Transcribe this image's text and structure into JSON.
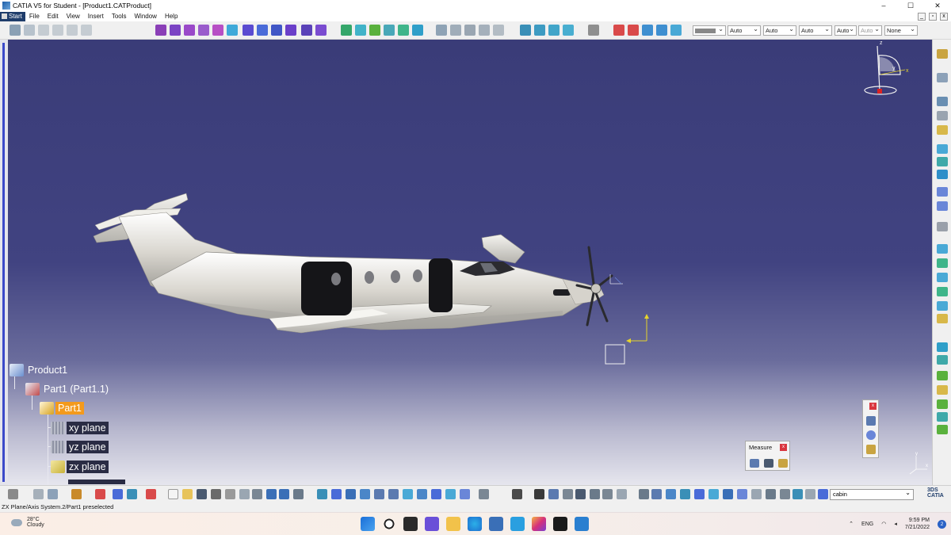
{
  "window": {
    "title": "CATIA V5 for Student - [Product1.CATProduct]",
    "controls": [
      "–",
      "☐",
      "✕"
    ]
  },
  "menu": {
    "start": "Start",
    "items": [
      "File",
      "Edit",
      "View",
      "Insert",
      "Tools",
      "Window",
      "Help"
    ]
  },
  "toolbar": {
    "combos": [
      {
        "value": ""
      },
      {
        "value": "Auto"
      },
      {
        "value": "Auto"
      },
      {
        "value": "Auto"
      },
      {
        "value": "Auto"
      },
      {
        "value": "Auto"
      },
      {
        "value": "None"
      }
    ]
  },
  "tree": {
    "nodes": [
      {
        "label": "Product1"
      },
      {
        "label": "Part1 (Part1.1)"
      },
      {
        "label": "Part1"
      },
      {
        "label": "xy plane"
      },
      {
        "label": "yz plane"
      },
      {
        "label": "zx plane"
      }
    ]
  },
  "compass": {
    "z": "z",
    "x": "x",
    "y": "y"
  },
  "measure": {
    "title": "Measure",
    "close": "x"
  },
  "palette": {
    "close": "x"
  },
  "axis_mini": {
    "y": "y",
    "x": "x"
  },
  "command_input": {
    "value": "cabin"
  },
  "status": {
    "text": "ZX Plane/Axis System.2/Part1 preselected"
  },
  "taskbar": {
    "weather_temp": "28°C",
    "weather_desc": "Cloudy",
    "language": "ENG",
    "time": "9:59 PM",
    "date": "7/21/2022",
    "notifications": "2"
  },
  "colors": {
    "accent": "#f39a1c",
    "sky_top": "#3a3c78",
    "brand": "#1f3d6b"
  }
}
